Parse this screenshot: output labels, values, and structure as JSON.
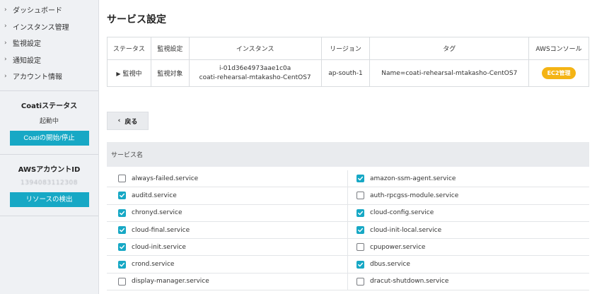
{
  "sidebar": {
    "nav": [
      {
        "label": "ダッシュボード",
        "name": "sidebar-item-dashboard"
      },
      {
        "label": "インスタンス管理",
        "name": "sidebar-item-instances"
      },
      {
        "label": "監視設定",
        "name": "sidebar-item-monitoring"
      },
      {
        "label": "通知設定",
        "name": "sidebar-item-notifications"
      },
      {
        "label": "アカウント情報",
        "name": "sidebar-item-account"
      }
    ],
    "coati_status": {
      "title": "Coatiステータス",
      "value": "起動中",
      "button": "Coatiの開始/停止"
    },
    "aws_account": {
      "title": "AWSアカウントID",
      "value": "1394083112308",
      "button": "リソースの検出"
    }
  },
  "main": {
    "title": "サービス設定",
    "table": {
      "headers": [
        "ステータス",
        "監視設定",
        "インスタンス",
        "リージョン",
        "タグ",
        "AWSコンソール"
      ],
      "row": {
        "status": "監視中",
        "monitoring": "監視対象",
        "instance_id": "i-01d36e4973aae1c0a",
        "instance_name": "coati-rehearsal-mtakasho-CentOS7",
        "region": "ap-south-1",
        "tag": "Name=coati-rehearsal-mtakasho-CentOS7",
        "console_badge": "EC2管理"
      }
    },
    "back_label": "戻る",
    "service_header": "サービス名",
    "services": [
      {
        "name": "always-failed.service",
        "checked": false
      },
      {
        "name": "amazon-ssm-agent.service",
        "checked": true
      },
      {
        "name": "auditd.service",
        "checked": true
      },
      {
        "name": "auth-rpcgss-module.service",
        "checked": false
      },
      {
        "name": "chronyd.service",
        "checked": true
      },
      {
        "name": "cloud-config.service",
        "checked": true
      },
      {
        "name": "cloud-final.service",
        "checked": true
      },
      {
        "name": "cloud-init-local.service",
        "checked": true
      },
      {
        "name": "cloud-init.service",
        "checked": true
      },
      {
        "name": "cpupower.service",
        "checked": false
      },
      {
        "name": "crond.service",
        "checked": true
      },
      {
        "name": "dbus.service",
        "checked": true
      },
      {
        "name": "display-manager.service",
        "checked": false
      },
      {
        "name": "dracut-shutdown.service",
        "checked": false
      }
    ]
  },
  "colors": {
    "accent": "#17a8c5",
    "badge": "#f4b415",
    "sidebar_bg": "#eff1f4"
  }
}
